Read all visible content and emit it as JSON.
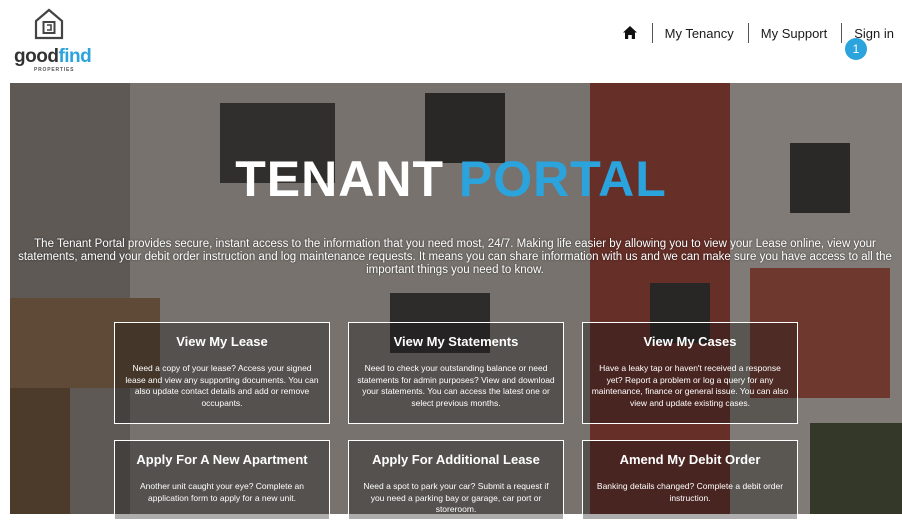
{
  "brand": {
    "name_part1": "good",
    "name_part2": "find",
    "sub": "PROPERTIES"
  },
  "nav": {
    "items": [
      {
        "label": "My Tenancy"
      },
      {
        "label": "My Support"
      },
      {
        "label": "Sign in"
      }
    ],
    "notification_count": "1"
  },
  "hero": {
    "title_part1": "TENANT",
    "title_part2": "PORTAL",
    "intro": "The Tenant Portal provides secure, instant access to the information that you need most, 24/7. Making life easier by allowing you to view your Lease online, view your statements, amend your debit order instruction and log maintenance requests. It means you can share information with us and we can make sure you have access to all the important things you need to know."
  },
  "cards": [
    {
      "title": "View My Lease",
      "text": "Need a copy of your lease? Access your signed lease and view any supporting documents. You can also update contact details and add or remove occupants."
    },
    {
      "title": "View My Statements",
      "text": "Need to check your outstanding balance or need statements for admin purposes? View and download your statements. You can access the latest one or select previous months."
    },
    {
      "title": "View My Cases",
      "text": "Have a leaky tap or haven't received a response yet? Report a problem or log a query for any maintenance, finance or general issue. You can also view and update existing cases."
    },
    {
      "title": "Apply For A New Apartment",
      "text": "Another unit caught your eye? Complete an application form to apply for a new unit."
    },
    {
      "title": "Apply For Additional Lease",
      "text": "Need a spot to park your car? Submit a request if you need a parking bay or garage, car port or storeroom."
    },
    {
      "title": "Amend My Debit Order",
      "text": "Banking details changed? Complete a debit order instruction."
    }
  ],
  "colors": {
    "accent": "#2ba3dd",
    "white": "#ffffff"
  },
  "icons": {
    "home": "home-icon",
    "logo": "house-logo-icon"
  }
}
